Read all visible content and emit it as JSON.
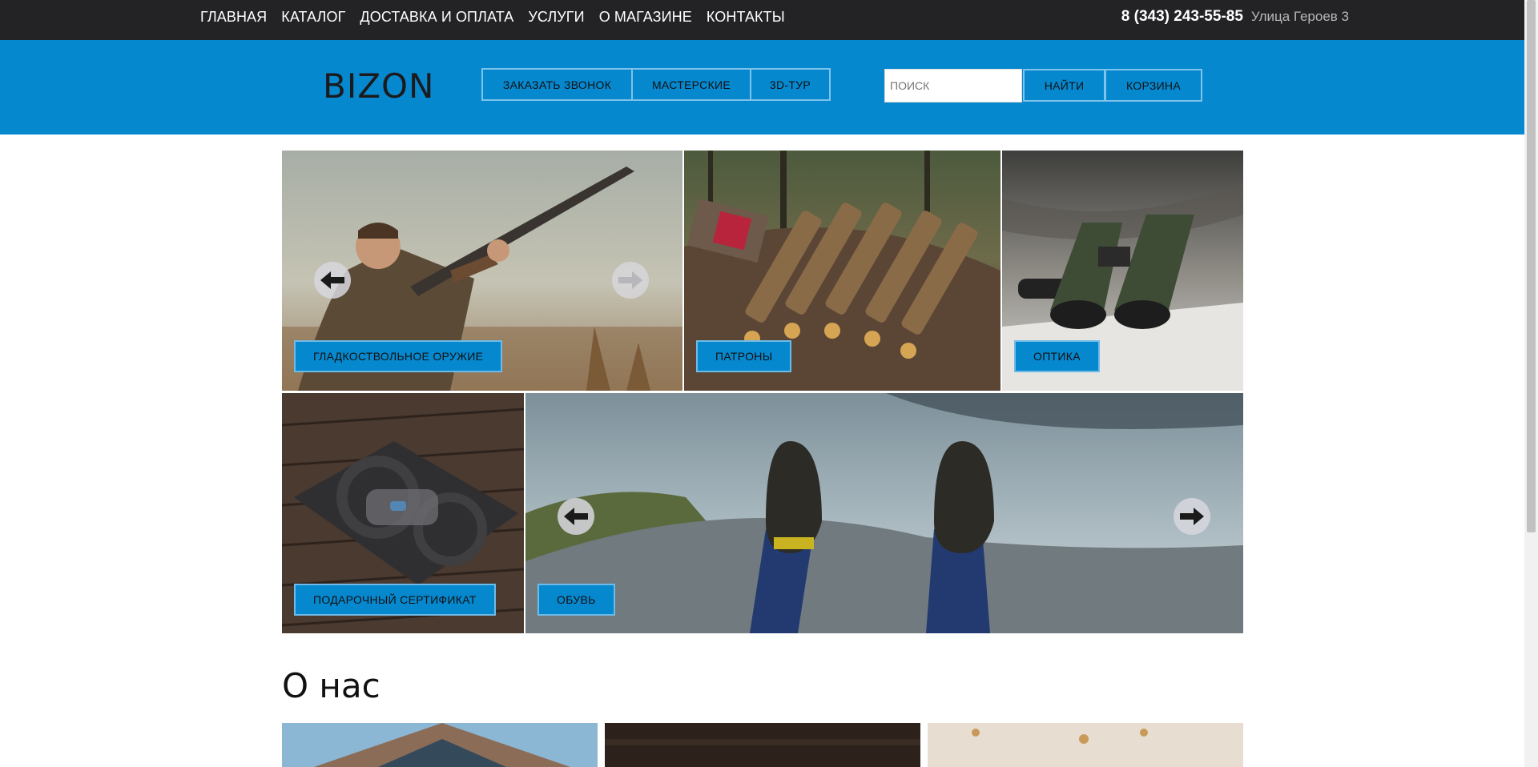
{
  "topnav": {
    "items": [
      "ГЛАВНАЯ",
      "КАТАЛОГ",
      "ДОСТАВКА И ОПЛАТА",
      "УСЛУГИ",
      "О МАГАЗИНЕ",
      "КОНТАКТЫ"
    ],
    "phone": "8 (343) 243-55-85",
    "address": "Улица Героев 3"
  },
  "header": {
    "logo": "BIZON",
    "buttons": [
      "ЗАКАЗАТЬ ЗВОНОК",
      "МАСТЕРСКИЕ",
      "3D-ТУР"
    ],
    "search_placeholder": "ПОИСК",
    "search_button": "НАЙТИ",
    "cart_button": "КОРЗИНА"
  },
  "catalog": {
    "tiles": [
      "ГЛАДКОСТВОЛЬНОЕ ОРУЖИЕ",
      "ПАТРОНЫ",
      "ОПТИКА",
      "ПОДАРОЧНЫЙ СЕРТИФИКАТ",
      "ОБУВЬ"
    ]
  },
  "about": {
    "title": "О нас"
  },
  "colors": {
    "accent": "#0688cf",
    "topbar": "#232325"
  },
  "icons": [
    "arrow-left-icon",
    "arrow-right-icon"
  ]
}
